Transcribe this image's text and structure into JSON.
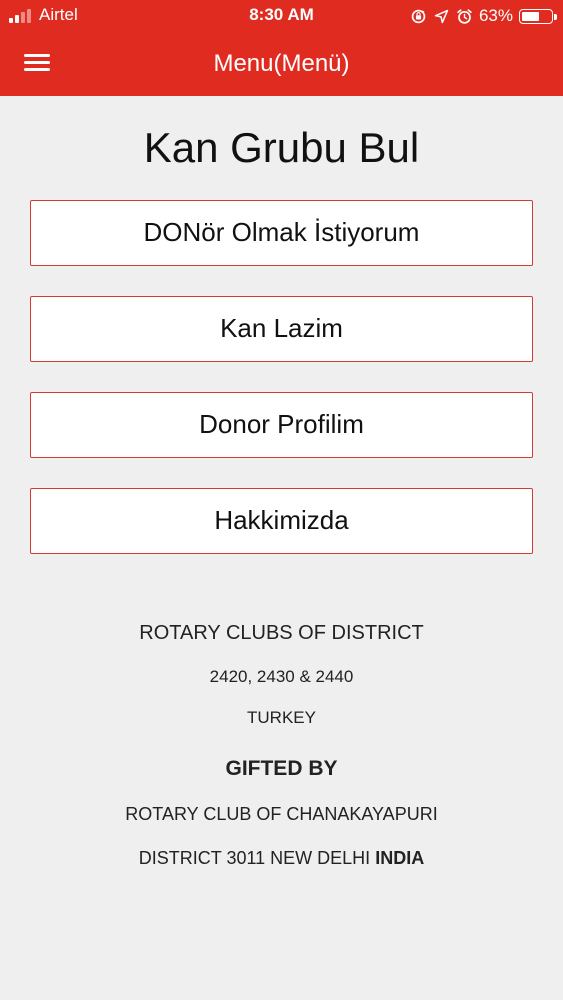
{
  "status_bar": {
    "carrier": "Airtel",
    "time": "8:30 AM",
    "battery_percent": "63%",
    "battery_level": 0.63,
    "icons": [
      "signal-icon",
      "screen-rotation-lock-icon",
      "location-arrow-icon",
      "alarm-icon",
      "battery-icon"
    ]
  },
  "nav": {
    "title": "Menu(Menü)",
    "menu_icon": "hamburger-menu-icon"
  },
  "page": {
    "title": "Kan Grubu Bul"
  },
  "buttons": [
    {
      "label": "DONör Olmak İstiyorum"
    },
    {
      "label": "Kan Lazim"
    },
    {
      "label": "Donor Profilim"
    },
    {
      "label": "Hakkimizda"
    }
  ],
  "footer": {
    "line1": "ROTARY CLUBS OF DISTRICT",
    "line2": "2420, 2430 & 2440",
    "line3": "TURKEY",
    "gifted_by": "GIFTED BY",
    "line4": "ROTARY CLUB OF CHANAKAYAPURI",
    "line5_prefix": "DISTRICT 3011 NEW DELHI",
    "line5_bold": "INDIA"
  },
  "colors": {
    "header": "#e02c20",
    "button_border": "#d33a32",
    "background": "#efeff0"
  }
}
